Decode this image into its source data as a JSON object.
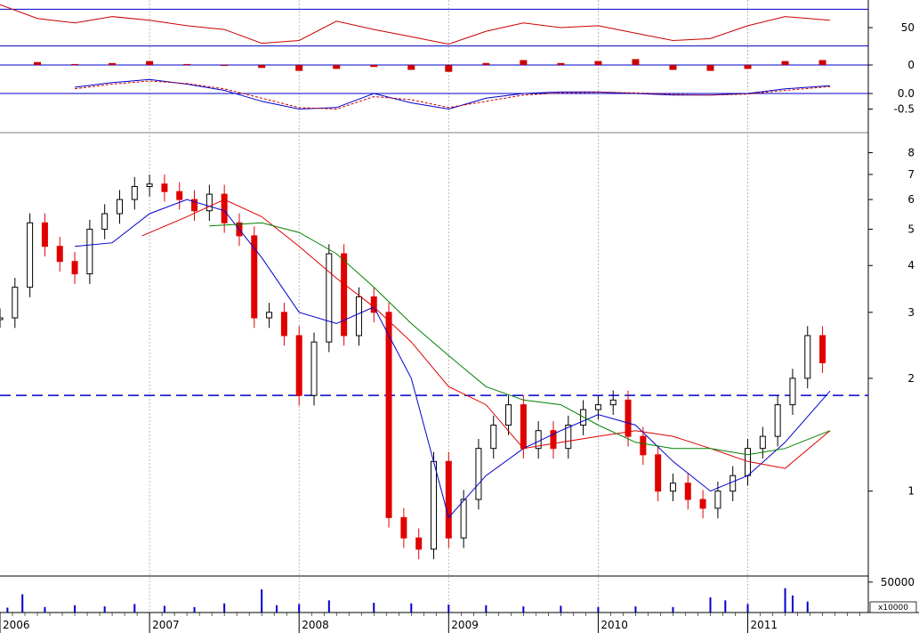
{
  "colors": {
    "up_candle": "#000000",
    "down_candle": "#e00000",
    "ma_short": "#0000cc",
    "ma_mid": "#e00000",
    "ma_long": "#008000",
    "oscillator": "#cc0000",
    "macd_line": "#0000cc",
    "signal_line": "#cc0000",
    "volume_bar": "#0000cc",
    "support_line": "#0000cc",
    "grid": "#aaaaaa",
    "background": "#ffffff"
  },
  "chart_data": [
    {
      "type": "line",
      "panel": "oscillator",
      "yaxis_labels": [
        "50"
      ],
      "reference_levels": [
        70,
        30
      ],
      "ylim": [
        20,
        80
      ],
      "x": [
        2006.0,
        2006.25,
        2006.5,
        2006.75,
        2007.0,
        2007.25,
        2007.5,
        2007.75,
        2008.0,
        2008.25,
        2008.5,
        2008.75,
        2009.0,
        2009.25,
        2009.5,
        2009.75,
        2010.0,
        2010.25,
        2010.5,
        2010.75,
        2011.0,
        2011.25,
        2011.55
      ],
      "values": [
        75,
        60,
        55,
        62,
        58,
        52,
        48,
        33,
        36,
        57,
        48,
        40,
        32,
        46,
        55,
        50,
        52,
        44,
        36,
        38,
        52,
        62,
        58
      ]
    },
    {
      "type": "bar",
      "panel": "momentum-histogram",
      "yaxis_labels": [
        "0"
      ],
      "ylim": [
        -10,
        10
      ],
      "x": [
        2006.25,
        2006.5,
        2006.75,
        2007.0,
        2007.25,
        2007.5,
        2007.75,
        2008.0,
        2008.25,
        2008.5,
        2008.75,
        2009.0,
        2009.25,
        2009.5,
        2009.75,
        2010.0,
        2010.25,
        2010.5,
        2010.75,
        2011.0,
        2011.25,
        2011.5
      ],
      "values": [
        3,
        1,
        2,
        4,
        1,
        -1,
        -3,
        -6,
        -4,
        -2,
        -5,
        -7,
        2,
        5,
        2,
        4,
        6,
        -5,
        -6,
        -4,
        4,
        5
      ]
    },
    {
      "type": "line",
      "panel": "macd",
      "yaxis_labels": [
        "0.0",
        "-0.5"
      ],
      "ylim": [
        -1,
        0.6
      ],
      "x": [
        2006.5,
        2006.75,
        2007.0,
        2007.25,
        2007.5,
        2007.75,
        2008.0,
        2008.25,
        2008.5,
        2008.75,
        2009.0,
        2009.25,
        2009.5,
        2009.75,
        2010.0,
        2010.25,
        2010.5,
        2010.75,
        2011.0,
        2011.25,
        2011.55
      ],
      "series": [
        {
          "values": [
            0.2,
            0.35,
            0.45,
            0.3,
            0.1,
            -0.25,
            -0.5,
            -0.45,
            0.0,
            -0.3,
            -0.5,
            -0.15,
            0.0,
            0.05,
            0.05,
            0.0,
            -0.05,
            -0.05,
            0.0,
            0.15,
            0.25
          ]
        },
        {
          "values": [
            0.15,
            0.3,
            0.4,
            0.32,
            0.15,
            -0.15,
            -0.45,
            -0.5,
            -0.1,
            -0.2,
            -0.45,
            -0.25,
            -0.05,
            0.02,
            0.04,
            0.02,
            -0.03,
            -0.05,
            -0.02,
            0.1,
            0.22
          ]
        }
      ]
    },
    {
      "type": "line",
      "panel": "price",
      "scale": "log",
      "ylim": [
        0.6,
        9
      ],
      "yaxis_labels": [
        "8",
        "7",
        "6",
        "5",
        "4",
        "3",
        "2",
        "1"
      ],
      "xaxis_labels": [
        "2006",
        "2007",
        "2008",
        "2009",
        "2010",
        "2011"
      ],
      "support_level": 1.8,
      "series": [
        {
          "kind": "close",
          "x": [
            2006.0,
            2006.1,
            2006.2,
            2006.3,
            2006.4,
            2006.5,
            2006.6,
            2006.7,
            2006.8,
            2006.9,
            2007.0,
            2007.1,
            2007.2,
            2007.3,
            2007.4,
            2007.5,
            2007.6,
            2007.7,
            2007.8,
            2007.9,
            2008.0,
            2008.1,
            2008.2,
            2008.3,
            2008.4,
            2008.5,
            2008.6,
            2008.7,
            2008.8,
            2008.9,
            2009.0,
            2009.1,
            2009.2,
            2009.3,
            2009.4,
            2009.5,
            2009.6,
            2009.7,
            2009.8,
            2009.9,
            2010.0,
            2010.1,
            2010.2,
            2010.3,
            2010.4,
            2010.5,
            2010.6,
            2010.7,
            2010.8,
            2010.9,
            2011.0,
            2011.1,
            2011.2,
            2011.3,
            2011.4,
            2011.5
          ],
          "values": [
            2.9,
            3.5,
            5.2,
            4.5,
            4.1,
            3.8,
            5.0,
            5.5,
            6.0,
            6.5,
            6.6,
            6.3,
            6.0,
            5.6,
            6.2,
            5.2,
            4.8,
            2.9,
            3.0,
            2.6,
            1.8,
            2.5,
            4.3,
            2.6,
            3.3,
            3.0,
            0.85,
            0.75,
            0.7,
            1.2,
            0.75,
            0.95,
            1.3,
            1.5,
            1.7,
            1.3,
            1.45,
            1.3,
            1.5,
            1.65,
            1.7,
            1.75,
            1.4,
            1.25,
            1.0,
            1.05,
            0.95,
            0.9,
            1.0,
            1.1,
            1.3,
            1.4,
            1.7,
            2.0,
            2.6,
            2.2
          ]
        },
        {
          "kind": "moving-average",
          "x": [
            2006.5,
            2006.75,
            2007.0,
            2007.25,
            2007.5,
            2007.75,
            2008.0,
            2008.25,
            2008.5,
            2008.75,
            2009.0,
            2009.25,
            2009.5,
            2009.75,
            2010.0,
            2010.25,
            2010.5,
            2010.75,
            2011.0,
            2011.25,
            2011.55
          ],
          "values": [
            4.5,
            4.6,
            5.5,
            6.0,
            5.6,
            4.2,
            3.0,
            2.8,
            3.1,
            2.0,
            0.85,
            1.1,
            1.3,
            1.45,
            1.6,
            1.5,
            1.2,
            1.0,
            1.1,
            1.35,
            1.85
          ]
        },
        {
          "kind": "moving-average",
          "x": [
            2006.95,
            2007.25,
            2007.5,
            2007.75,
            2008.0,
            2008.25,
            2008.5,
            2008.75,
            2009.0,
            2009.25,
            2009.5,
            2009.75,
            2010.0,
            2010.25,
            2010.5,
            2010.75,
            2011.0,
            2011.25,
            2011.55
          ],
          "values": [
            4.8,
            5.4,
            6.0,
            5.4,
            4.5,
            3.7,
            3.1,
            2.5,
            1.9,
            1.7,
            1.3,
            1.35,
            1.4,
            1.45,
            1.4,
            1.3,
            1.2,
            1.15,
            1.45
          ]
        },
        {
          "kind": "moving-average",
          "x": [
            2007.4,
            2007.75,
            2008.0,
            2008.25,
            2008.5,
            2008.75,
            2009.0,
            2009.25,
            2009.5,
            2009.75,
            2010.0,
            2010.25,
            2010.5,
            2010.75,
            2011.0,
            2011.25,
            2011.55
          ],
          "values": [
            5.1,
            5.2,
            4.9,
            4.3,
            3.5,
            2.8,
            2.3,
            1.9,
            1.75,
            1.7,
            1.5,
            1.35,
            1.3,
            1.3,
            1.25,
            1.3,
            1.45
          ]
        }
      ]
    },
    {
      "type": "bar",
      "panel": "volume",
      "yaxis_labels": [
        "50000"
      ],
      "unit_label": "x10000",
      "ylim": [
        0,
        60000
      ],
      "x": [
        2006.05,
        2006.15,
        2006.3,
        2006.5,
        2006.7,
        2006.9,
        2007.1,
        2007.3,
        2007.5,
        2007.75,
        2007.85,
        2008.0,
        2008.2,
        2008.5,
        2008.75,
        2009.0,
        2009.25,
        2009.5,
        2009.75,
        2010.0,
        2010.25,
        2010.5,
        2010.75,
        2010.85,
        2011.0,
        2011.25,
        2011.3,
        2011.4
      ],
      "values": [
        8000,
        30000,
        9000,
        12000,
        10000,
        14000,
        11000,
        9000,
        15000,
        38000,
        12000,
        14000,
        20000,
        16000,
        15000,
        13000,
        12000,
        10000,
        11000,
        9000,
        10000,
        9000,
        25000,
        20000,
        14000,
        40000,
        28000,
        18000
      ]
    }
  ]
}
